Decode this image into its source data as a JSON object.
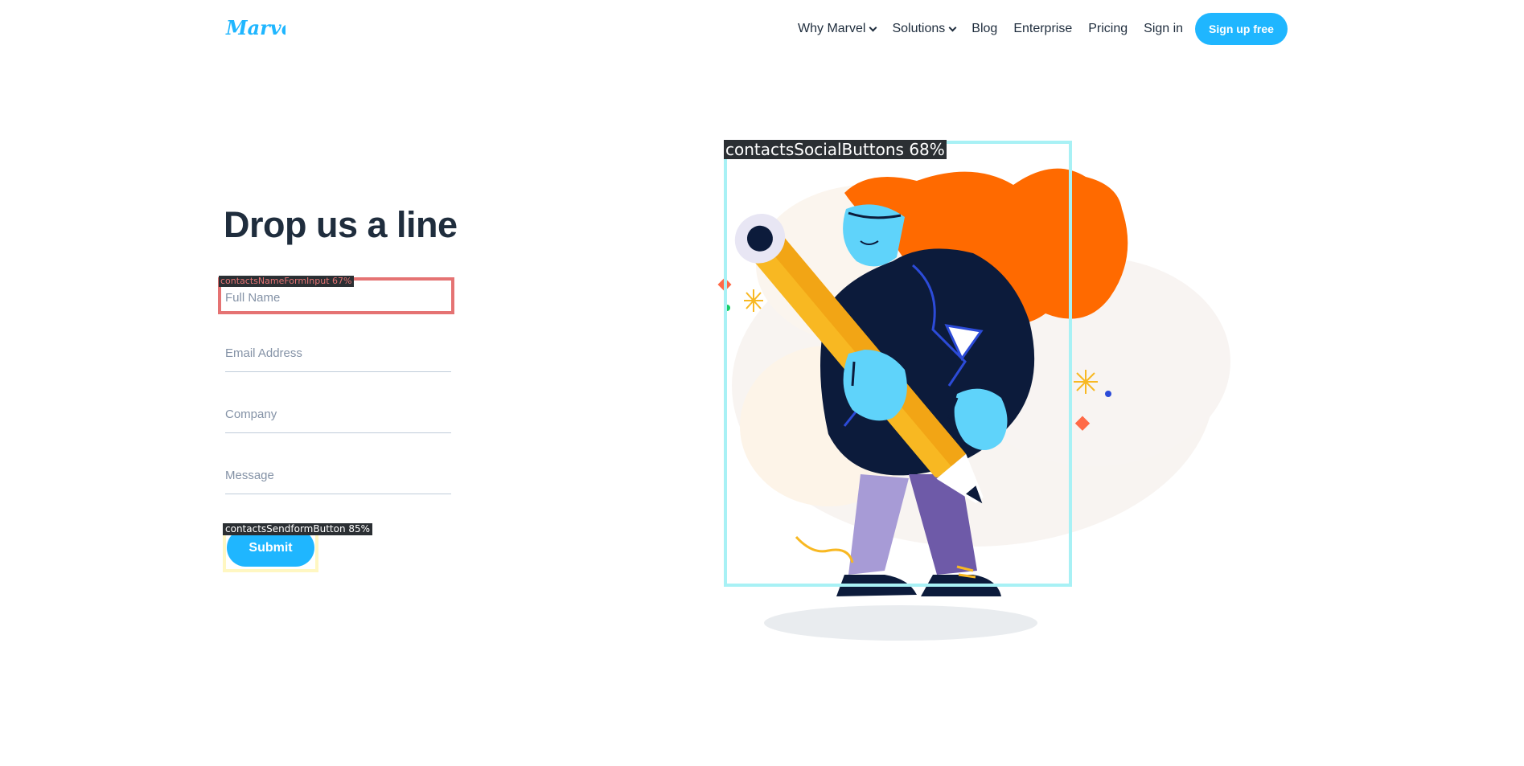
{
  "brand": {
    "logo_text": "Marvel"
  },
  "nav": {
    "items": [
      {
        "label": "Why Marvel",
        "has_dropdown": true
      },
      {
        "label": "Solutions",
        "has_dropdown": true
      },
      {
        "label": "Blog",
        "has_dropdown": false
      },
      {
        "label": "Enterprise",
        "has_dropdown": false
      },
      {
        "label": "Pricing",
        "has_dropdown": false
      },
      {
        "label": "Sign in",
        "has_dropdown": false
      }
    ],
    "signup_label": "Sign up free"
  },
  "form": {
    "title": "Drop us a line",
    "fields": [
      {
        "placeholder": "Full Name",
        "value": ""
      },
      {
        "placeholder": "Email Address",
        "value": ""
      },
      {
        "placeholder": "Company",
        "value": ""
      },
      {
        "placeholder": "Message",
        "value": ""
      }
    ],
    "submit_label": "Submit"
  },
  "overlays": {
    "name_input": "contactsNameFormInput 67%",
    "submit_button": "contactsSendformButton 85%",
    "social_buttons": "contactsSocialButtons 68%"
  },
  "colors": {
    "accent": "#1fb6ff",
    "text": "#1f2d3d",
    "hair": "#ff6a00",
    "pencil": "#f8b822",
    "skin": "#5fd3fa",
    "coat": "#0c1b3b",
    "pants": "#8f7ec6"
  },
  "icons": [
    "marvel-logo",
    "chevron-down-icon",
    "illustration-woman-with-pencil"
  ]
}
